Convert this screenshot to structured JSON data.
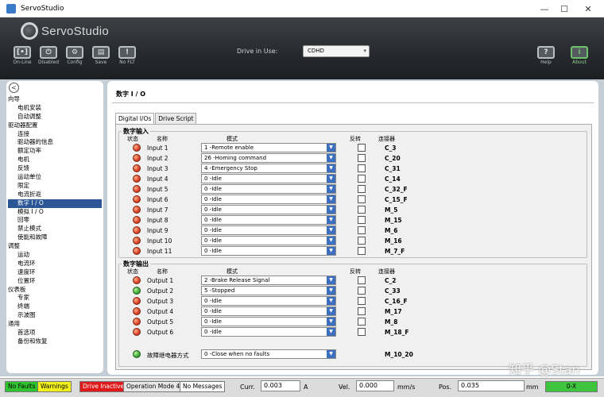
{
  "window": {
    "title": "ServoStudio",
    "minimize": "—",
    "maximize": "☐",
    "close": "✕"
  },
  "toolbar": {
    "logo": "ServoStudio",
    "buttons": [
      {
        "label": "On-Line",
        "glyph": "[•]"
      },
      {
        "label": "Disabled",
        "glyph": "⏻"
      },
      {
        "label": "Config",
        "glyph": "⚙"
      },
      {
        "label": "Save",
        "glyph": "▤"
      },
      {
        "label": "No FLT",
        "glyph": "!"
      }
    ],
    "drive_label": "Drive in Use:",
    "drive_value": "CDHD",
    "help": {
      "label": "Help",
      "glyph": "?"
    },
    "about": {
      "label": "About",
      "glyph": "i"
    }
  },
  "sidebar": {
    "back_glyph": "<",
    "items": [
      {
        "label": "向导",
        "level": "h"
      },
      {
        "label": "电机安装",
        "level": "c"
      },
      {
        "label": "自动调整",
        "level": "c"
      },
      {
        "label": "驱动器配置",
        "level": "h"
      },
      {
        "label": "连接",
        "level": "c"
      },
      {
        "label": "驱动器的信息",
        "level": "c"
      },
      {
        "label": "额定功率",
        "level": "c"
      },
      {
        "label": "电机",
        "level": "c"
      },
      {
        "label": "反馈",
        "level": "c"
      },
      {
        "label": "运动单位",
        "level": "c"
      },
      {
        "label": "限定",
        "level": "c"
      },
      {
        "label": "电流折返",
        "level": "c"
      },
      {
        "label": "数字 I / O",
        "level": "c",
        "selected": true
      },
      {
        "label": "模拟 I / O",
        "level": "c"
      },
      {
        "label": "回零",
        "level": "c"
      },
      {
        "label": "禁止模式",
        "level": "c"
      },
      {
        "label": "使能和故障",
        "level": "c"
      },
      {
        "label": "调整",
        "level": "h"
      },
      {
        "label": "运动",
        "level": "c"
      },
      {
        "label": "电流环",
        "level": "c"
      },
      {
        "label": "速度环",
        "level": "c"
      },
      {
        "label": "位置环",
        "level": "c"
      },
      {
        "label": "仪表板",
        "level": "h"
      },
      {
        "label": "专家",
        "level": "c"
      },
      {
        "label": "终端",
        "level": "c"
      },
      {
        "label": "示波图",
        "level": "c"
      },
      {
        "label": "通用",
        "level": "h"
      },
      {
        "label": "首选项",
        "level": "c"
      },
      {
        "label": "备份和恢复",
        "level": "c"
      }
    ]
  },
  "main": {
    "title": "数字 I / O",
    "tabs": [
      "Digital I/Os",
      "Drive Script"
    ],
    "inputs": {
      "title": "数字输入",
      "headers": {
        "status": "状态",
        "name": "名称",
        "mode": "模式",
        "invert": "反转",
        "connector": "连接器"
      },
      "rows": [
        {
          "name": "Input 1",
          "mode": "1  -Remote enable",
          "connector": "C_3",
          "led": "red"
        },
        {
          "name": "Input 2",
          "mode": "26  -Homing command",
          "connector": "C_20",
          "led": "red"
        },
        {
          "name": "Input 3",
          "mode": "4  -Emergency Stop",
          "connector": "C_31",
          "led": "red"
        },
        {
          "name": "Input 4",
          "mode": "0  -Idle",
          "connector": "C_14",
          "led": "red"
        },
        {
          "name": "Input 5",
          "mode": "0  -Idle",
          "connector": "C_32_F",
          "led": "red"
        },
        {
          "name": "Input 6",
          "mode": "0  -Idle",
          "connector": "C_15_F",
          "led": "red"
        },
        {
          "name": "Input 7",
          "mode": "0  -Idle",
          "connector": "M_5",
          "led": "red"
        },
        {
          "name": "Input 8",
          "mode": "0  -Idle",
          "connector": "M_15",
          "led": "red"
        },
        {
          "name": "Input 9",
          "mode": "0  -Idle",
          "connector": "M_6",
          "led": "red"
        },
        {
          "name": "Input 10",
          "mode": "0  -Idle",
          "connector": "M_16",
          "led": "red"
        },
        {
          "name": "Input 11",
          "mode": "0  -Idle",
          "connector": "M_7_F",
          "led": "red"
        }
      ]
    },
    "outputs": {
      "title": "数字输出",
      "headers": {
        "status": "状态",
        "name": "名称",
        "mode": "模式",
        "invert": "反转",
        "connector": "连接器"
      },
      "rows": [
        {
          "name": "Output 1",
          "mode": "2  -Brake Release Signal",
          "connector": "C_2",
          "led": "red"
        },
        {
          "name": "Output 2",
          "mode": "5  -Stopped",
          "connector": "C_33",
          "led": "green"
        },
        {
          "name": "Output 3",
          "mode": "0  -Idle",
          "connector": "C_16_F",
          "led": "red"
        },
        {
          "name": "Output 4",
          "mode": "0  -Idle",
          "connector": "M_17",
          "led": "red"
        },
        {
          "name": "Output 5",
          "mode": "0  -Idle",
          "connector": "M_8",
          "led": "red"
        },
        {
          "name": "Output 6",
          "mode": "0  -Idle",
          "connector": "M_18_F",
          "led": "red"
        }
      ],
      "fault_relay": {
        "name": "故障继电器方式",
        "mode": "0  -Close when no faults",
        "connector": "M_10_20",
        "led": "green"
      }
    }
  },
  "status": {
    "no_faults": "No Faults",
    "warnings": "Warnings",
    "drive_inactive": "Drive Inactive",
    "op_mode": "Operation Mode 4",
    "messages": "No Messages",
    "curr_label": "Curr.",
    "curr_value": "0.003",
    "curr_unit": "A",
    "vel_label": "Vel.",
    "vel_value": "0.000",
    "vel_unit": "mm/s",
    "pos_label": "Pos.",
    "pos_value": "0.035",
    "pos_unit": "mm",
    "indicator": "0-X",
    "colors": {
      "no_faults": "#2fc42f",
      "warnings": "#f2f21a",
      "drive_inactive": "#e01a1a"
    }
  },
  "watermark": "知乎 @Stan"
}
